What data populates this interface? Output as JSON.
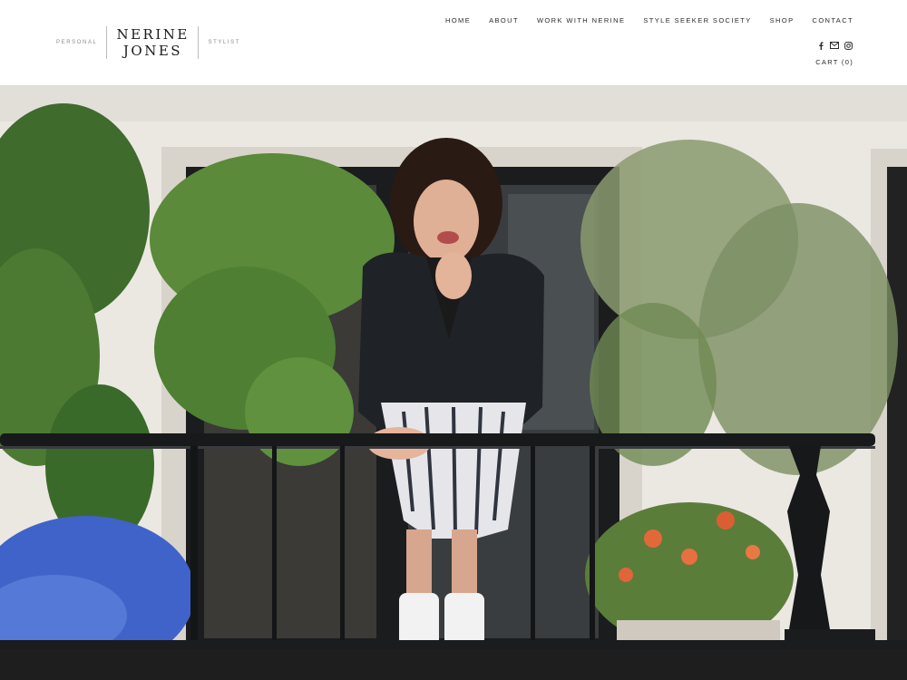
{
  "brand": {
    "left_tag": "PERSONAL",
    "name_line1": "NERINE",
    "name_line2": "JONES",
    "right_tag": "STYLIST"
  },
  "nav": {
    "items": [
      {
        "label": "HOME"
      },
      {
        "label": "ABOUT"
      },
      {
        "label": "WORK WITH NERINE"
      },
      {
        "label": "STYLE SEEKER SOCIETY"
      },
      {
        "label": "SHOP"
      },
      {
        "label": "CONTACT"
      }
    ]
  },
  "social": {
    "icons": [
      "facebook-icon",
      "email-icon",
      "instagram-icon"
    ]
  },
  "cart": {
    "label": "CART (0)"
  },
  "colors": {
    "text": "#2a2a2a",
    "muted": "#8c8c8c",
    "footer": "#1e1e1e",
    "wall": "#efece7"
  }
}
